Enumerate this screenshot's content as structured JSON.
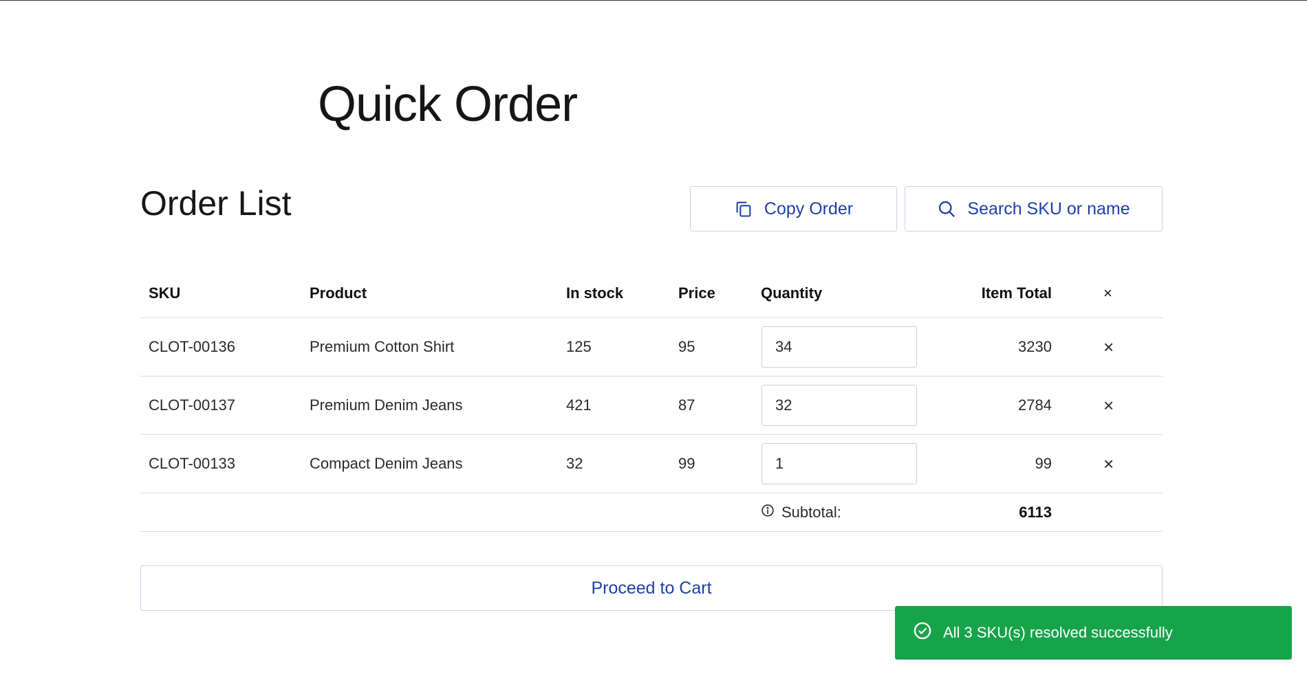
{
  "page": {
    "title": "Quick Order"
  },
  "order_list": {
    "title": "Order List",
    "copy_button": {
      "label": "Copy Order",
      "icon": "copy-icon"
    },
    "search_button": {
      "label": "Search SKU or name",
      "icon": "search-icon"
    }
  },
  "table": {
    "columns": {
      "sku": "SKU",
      "product": "Product",
      "in_stock": "In stock",
      "price": "Price",
      "quantity": "Quantity",
      "item_total": "Item Total",
      "remove_all": "×"
    },
    "rows": [
      {
        "sku": "CLOT-00136",
        "product": "Premium Cotton Shirt",
        "in_stock": "125",
        "price": "95",
        "quantity": "34",
        "item_total": "3230",
        "remove": "×"
      },
      {
        "sku": "CLOT-00137",
        "product": "Premium Denim Jeans",
        "in_stock": "421",
        "price": "87",
        "quantity": "32",
        "item_total": "2784",
        "remove": "×"
      },
      {
        "sku": "CLOT-00133",
        "product": "Compact Denim Jeans",
        "in_stock": "32",
        "price": "99",
        "quantity": "1",
        "item_total": "99",
        "remove": "×"
      }
    ],
    "subtotal": {
      "label": "Subtotal:",
      "value": "6113",
      "icon": "info-icon"
    }
  },
  "cart_button": {
    "label": "Proceed to Cart"
  },
  "toast": {
    "message": "All 3 SKU(s) resolved successfully",
    "icon": "check-circle-icon",
    "color": "#17a34a"
  },
  "colors": {
    "accent": "#1e40a8",
    "success": "#17a34a"
  }
}
